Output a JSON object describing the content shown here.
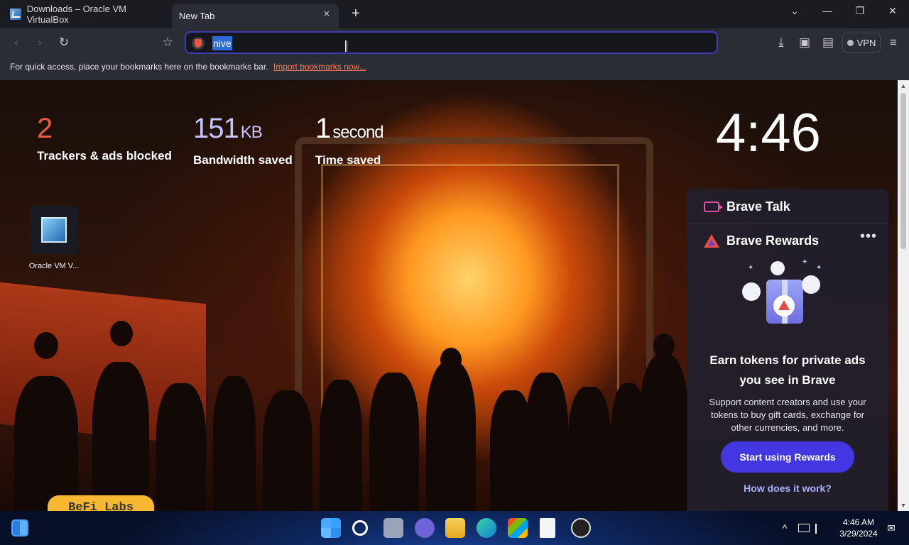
{
  "tabs": [
    {
      "title": "Downloads – Oracle VM VirtualBox",
      "active": false
    },
    {
      "title": "New Tab",
      "active": true
    }
  ],
  "icons": {
    "tab_close": "×",
    "new_tab": "+",
    "tab_list": "⌄",
    "minimize": "—",
    "maximize": "❐",
    "close": "✕",
    "back": "‹",
    "forward": "›",
    "reload": "↻",
    "bookmark": "☆",
    "download": "⤓",
    "sidebar": "▣",
    "wallet": "▤",
    "menu": "≡",
    "more": "•••",
    "scroll_up": "▲",
    "scroll_down": "▼",
    "chevron_up": "^",
    "notification": "✉"
  },
  "omnibox": {
    "text": "nive"
  },
  "vpn_label": "VPN",
  "bookmarks_bar": {
    "message": "For quick access, place your bookmarks here on the bookmarks bar.",
    "import_link": "Import bookmarks now..."
  },
  "stats": {
    "trackers": {
      "value": "2",
      "label": "Trackers & ads blocked",
      "color": "#f05a3c"
    },
    "bandwidth": {
      "value": "151",
      "unit": "KB",
      "label": "Bandwidth saved",
      "color": "#c7c4ff"
    },
    "time": {
      "value": "1",
      "unit": "second",
      "label": "Time saved"
    }
  },
  "clock": "4:46",
  "desktop_shortcut": {
    "label": "Oracle VM V..."
  },
  "befi_label": "BeFi Labs",
  "brave_talk": {
    "title": "Brave Talk"
  },
  "brave_rewards": {
    "title": "Brave Rewards",
    "headline": "Earn tokens for private ads you see in Brave",
    "description": "Support content creators and use your tokens to buy gift cards, exchange for other currencies, and more.",
    "cta": "Start using Rewards",
    "link": "How does it work?"
  },
  "taskbar": {
    "time": "4:46 AM",
    "date": "3/29/2024"
  },
  "colors": {
    "accent": "#4436e0",
    "omnibox_border": "#3b3eb8",
    "link": "#ff7a5c"
  }
}
